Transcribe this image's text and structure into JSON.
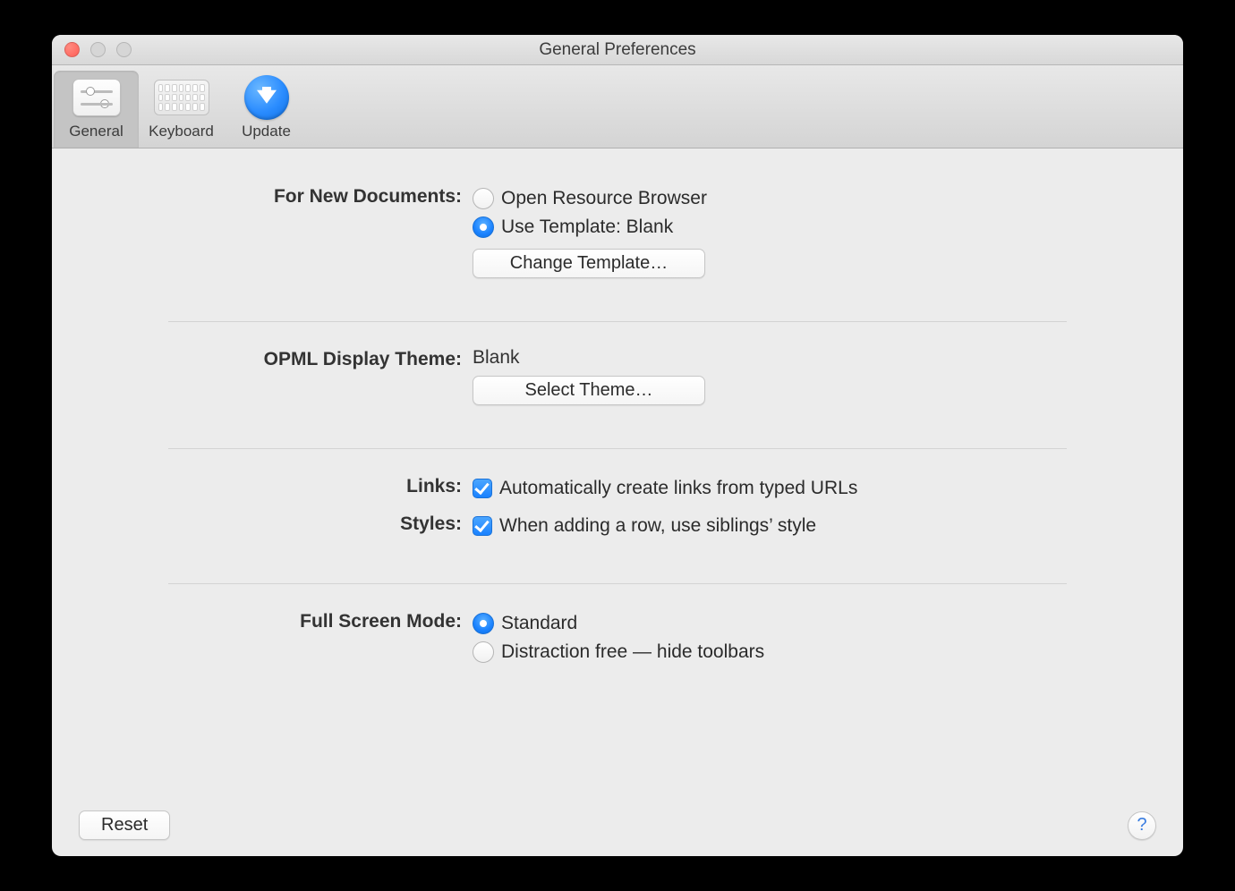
{
  "window": {
    "title": "General Preferences"
  },
  "toolbar": {
    "items": [
      {
        "label": "General",
        "icon": "sliders-icon",
        "selected": true
      },
      {
        "label": "Keyboard",
        "icon": "keyboard-icon",
        "selected": false
      },
      {
        "label": "Update",
        "icon": "download-arrow-icon",
        "selected": false
      }
    ]
  },
  "sections": {
    "newDocuments": {
      "label": "For New Documents:",
      "options": [
        {
          "label": "Open Resource Browser",
          "selected": false
        },
        {
          "label": "Use Template: Blank",
          "selected": true
        }
      ],
      "changeTemplateButton": "Change Template…"
    },
    "opmlTheme": {
      "label": "OPML Display Theme:",
      "value": "Blank",
      "selectThemeButton": "Select Theme…"
    },
    "links": {
      "label": "Links:",
      "checkbox": {
        "label": "Automatically create links from typed URLs",
        "checked": true
      }
    },
    "styles": {
      "label": "Styles:",
      "checkbox": {
        "label": "When adding a row, use siblings’ style",
        "checked": true
      }
    },
    "fullScreen": {
      "label": "Full Screen Mode:",
      "options": [
        {
          "label": "Standard",
          "selected": true
        },
        {
          "label": "Distraction free — hide toolbars",
          "selected": false
        }
      ]
    }
  },
  "footer": {
    "resetButton": "Reset",
    "helpButton": "?"
  }
}
